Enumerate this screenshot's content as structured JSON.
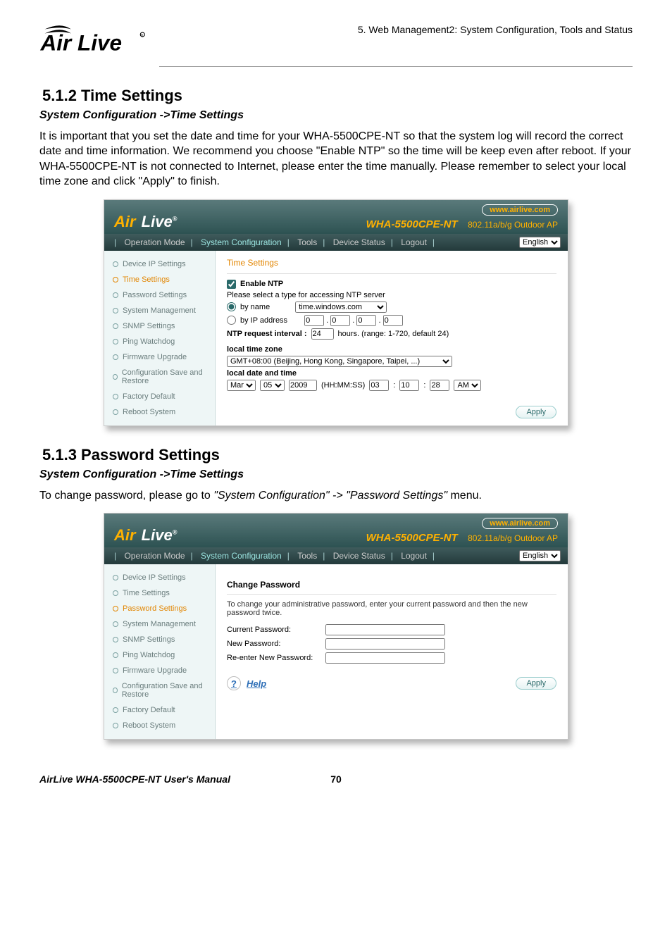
{
  "header": {
    "breadcrumb": "5.  Web  Management2:  System  Configuration,  Tools  and  Status"
  },
  "section1": {
    "number": "5.1.2 Time Settings",
    "subhead": "System Configuration ->Time Settings",
    "body": "It is important that you set the date and time for your WHA-5500CPE-NT so that the system log will record the correct date and time information.    We recommend you choose \"Enable NTP\" so the time will be keep even after reboot.    If your WHA-5500CPE-NT is not connected to Internet, please enter the time manually.    Please remember to select your local time zone and click \"Apply\" to finish."
  },
  "section2": {
    "number": "5.1.3 Password Settings",
    "subhead": "System Configuration ->Time Settings",
    "body_prefix": "To change password, please go to ",
    "body_italic": "\"System Configuration\" -> \"Password Settings\"",
    "body_suffix": " menu."
  },
  "router_ui": {
    "www": "www.airlive.com",
    "model": "WHA-5500CPE-NT",
    "subtitle": "802.11a/b/g Outdoor AP",
    "tabs": {
      "op": "Operation Mode",
      "sys": "System Configuration",
      "tools": "Tools",
      "status": "Device Status",
      "logout": "Logout"
    },
    "lang": "English",
    "sidebar": [
      "Device IP Settings",
      "Time Settings",
      "Password Settings",
      "System Management",
      "SNMP Settings",
      "Ping Watchdog",
      "Firmware Upgrade",
      "Configuration Save and Restore",
      "Factory Default",
      "Reboot System"
    ],
    "apply": "Apply"
  },
  "time_panel": {
    "title": "Time Settings",
    "enable": "Enable NTP",
    "select_text": "Please select a type for accessing NTP server",
    "by_name": "by name",
    "ntp_server": "time.windows.com",
    "by_ip": "by IP address",
    "ip": [
      "0",
      "0",
      "0",
      "0"
    ],
    "interval_label": "NTP request interval :",
    "interval_val": "24",
    "interval_unit": "hours. (range: 1-720, default 24)",
    "tz_label": "local time zone",
    "tz_val": "GMT+08:00 (Beijing, Hong Kong, Singapore, Taipei, ...)",
    "date_label": "local date and time",
    "month": "Mar",
    "day": "05",
    "year": "2009",
    "hhmmss": "(HH:MM:SS)",
    "hh": "03",
    "mm": "10",
    "ss": "28",
    "ampm": "AM"
  },
  "pw_panel": {
    "title": "Change Password",
    "desc": "To change your administrative password, enter your current password and then the new password twice.",
    "rows": [
      "Current Password:",
      "New Password:",
      "Re-enter New Password:"
    ],
    "help": "Help"
  },
  "footer": {
    "manual": "AirLive WHA-5500CPE-NT User's Manual",
    "page": "70"
  }
}
